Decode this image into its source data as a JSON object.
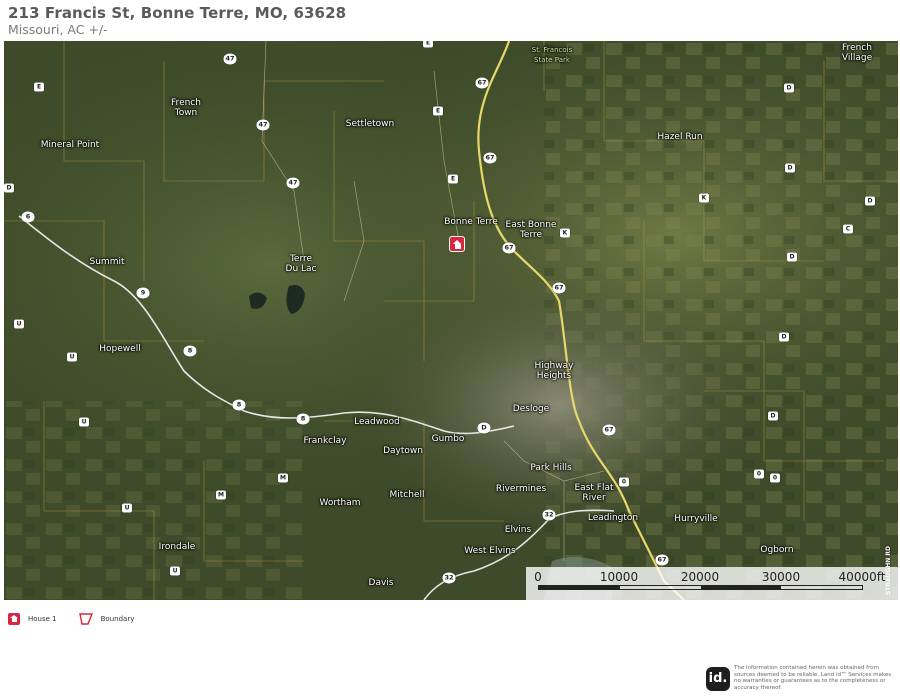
{
  "header": {
    "title": "213 Francis St, Bonne Terre, MO, 63628",
    "subtitle": "Missouri,  AC +/-"
  },
  "map": {
    "places": [
      {
        "id": "french-village",
        "label": "French\nVillage"
      },
      {
        "id": "st-francois-state-park",
        "label": "St. Francois\nState Park"
      },
      {
        "id": "french-town",
        "label": "French\nTown"
      },
      {
        "id": "settletown",
        "label": "Settletown"
      },
      {
        "id": "hazel-run",
        "label": "Hazel Run"
      },
      {
        "id": "mineral-point",
        "label": "Mineral Point"
      },
      {
        "id": "bonne-terre",
        "label": "Bonne Terre"
      },
      {
        "id": "east-bonne-terre",
        "label": "East Bonne\nTerre"
      },
      {
        "id": "summit",
        "label": "Summit"
      },
      {
        "id": "terre-du-lac",
        "label": "Terre\nDu Lac"
      },
      {
        "id": "hopewell",
        "label": "Hopewell"
      },
      {
        "id": "highway-heights",
        "label": "Highway\nHeights"
      },
      {
        "id": "leadwood",
        "label": "Leadwood"
      },
      {
        "id": "desloge",
        "label": "Desloge"
      },
      {
        "id": "frankclay",
        "label": "Frankclay"
      },
      {
        "id": "gumbo",
        "label": "Gumbo"
      },
      {
        "id": "daytown",
        "label": "Daytown"
      },
      {
        "id": "park-hills",
        "label": "Park Hills"
      },
      {
        "id": "rivermines",
        "label": "Rivermines"
      },
      {
        "id": "east-flat-river",
        "label": "East Flat\nRiver"
      },
      {
        "id": "mitchell",
        "label": "Mitchell"
      },
      {
        "id": "wortham",
        "label": "Wortham"
      },
      {
        "id": "leadington",
        "label": "Leadington"
      },
      {
        "id": "hurryville",
        "label": "Hurryville"
      },
      {
        "id": "elvins",
        "label": "Elvins"
      },
      {
        "id": "irondale",
        "label": "Irondale"
      },
      {
        "id": "west-elvins",
        "label": "West Elvins"
      },
      {
        "id": "ogborn",
        "label": "Ogborn"
      },
      {
        "id": "davis",
        "label": "Davis"
      }
    ],
    "shields": [
      "E",
      "47",
      "E",
      "47",
      "67",
      "E",
      "D",
      "67",
      "E",
      "47",
      "D",
      "K",
      "D",
      "D",
      "C",
      "6",
      "D",
      "K",
      "67",
      "9",
      "U",
      "67",
      "D",
      "U",
      "8",
      "U",
      "8",
      "8",
      "D",
      "D",
      "67",
      "0",
      "0",
      "0",
      "M",
      "M",
      "U",
      "32",
      "67",
      "U",
      "32"
    ],
    "road_label_vertical": "STRAUGHN RD",
    "scale": {
      "labels": [
        "0",
        "10000",
        "20000",
        "30000",
        "40000ft"
      ]
    },
    "colors": {
      "highway": "#e8d86a",
      "road": "#e6e6e6",
      "boundary": "#c8a040",
      "marker": "#d7263d"
    }
  },
  "legend": [
    {
      "icon": "house-icon",
      "label": "House 1"
    },
    {
      "icon": "boundary-icon",
      "label": "Boundary"
    }
  ],
  "footer": {
    "logo": "id.",
    "disclaimer": "The information contained herein was obtained from sources deemed to be reliable. Land id™ Services makes no warranties or guarantees as to the completeness or accuracy thereof."
  }
}
